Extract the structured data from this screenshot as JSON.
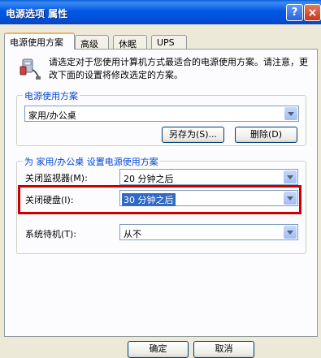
{
  "window": {
    "title": "电源选项 属性",
    "help_label": "?",
    "close_label": "×"
  },
  "tabs": [
    {
      "label": "电源使用方案",
      "active": true
    },
    {
      "label": "高级"
    },
    {
      "label": "休眠"
    },
    {
      "label": "UPS"
    }
  ],
  "intro": {
    "text": "请选定对于您使用计算机方式最适合的电源使用方案。请注意，更改下面的设置将修改选定的方案。",
    "icon": "power-plug-icon"
  },
  "scheme_group": {
    "label": "电源使用方案",
    "selected": "家用/办公桌",
    "save_as_label": "另存为(S)...",
    "delete_label": "删除(D)"
  },
  "settings_group": {
    "label": "为 家用/办公桌 设置电源使用方案",
    "monitor": {
      "label": "关闭监视器(M):",
      "value": "20 分钟之后"
    },
    "hard_disk": {
      "label": "关闭硬盘(I):",
      "value": "30 分钟之后"
    },
    "standby": {
      "label": "系统待机(T):",
      "value": "从不"
    }
  },
  "footer": {
    "ok_label": "确定",
    "cancel_label": "取消"
  },
  "colors": {
    "highlight": "#c80000",
    "title_blue": "#0058e6",
    "group_label": "#0046d5"
  }
}
